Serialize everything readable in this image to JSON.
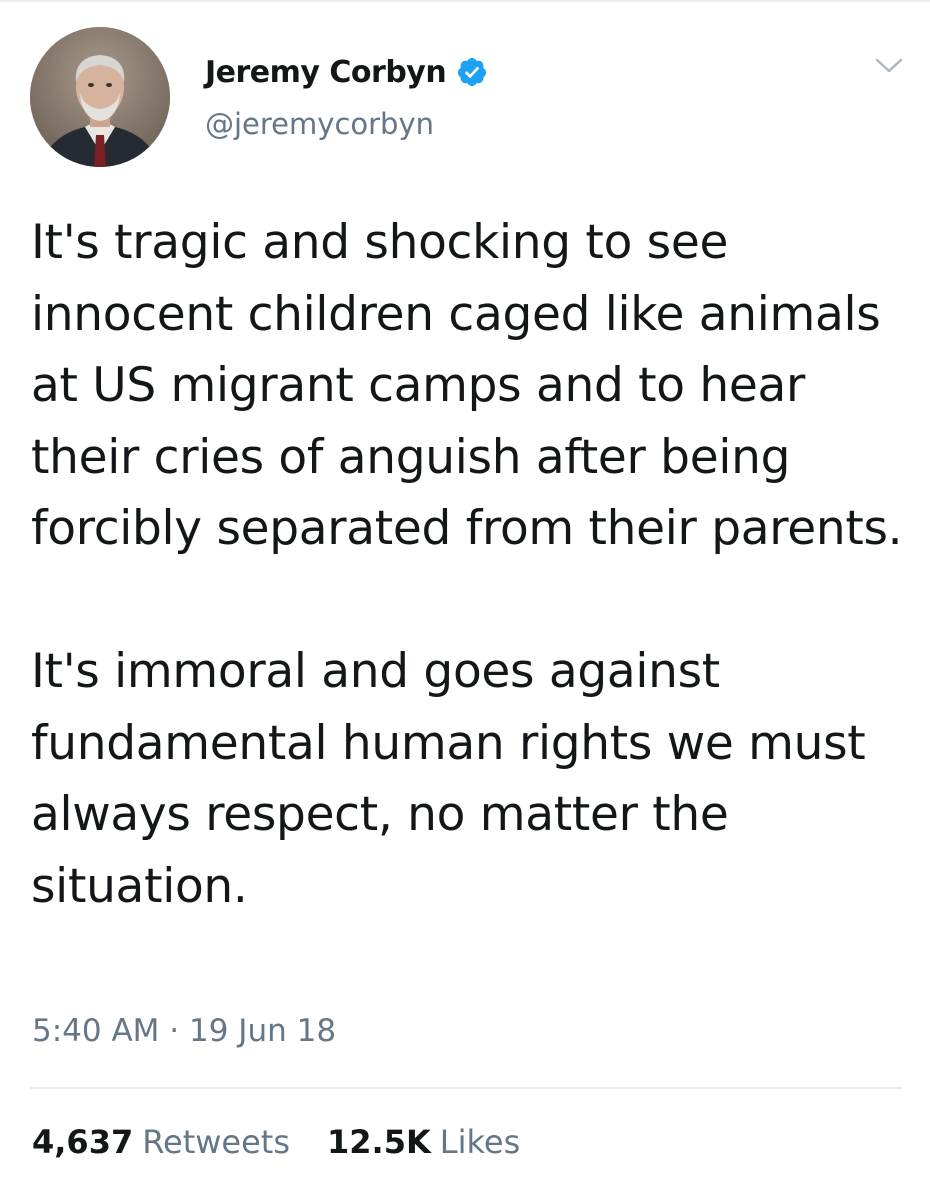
{
  "author": {
    "display_name": "Jeremy Corbyn",
    "handle": "@jeremycorbyn",
    "verified": true
  },
  "icons": {
    "verified": "verified-badge-icon",
    "menu": "chevron-down-icon"
  },
  "tweet": {
    "paragraphs": [
      "It's tragic and shocking to see innocent children caged like animals at US migrant camps and to hear their cries of anguish after being forcibly separated from their parents.",
      "It's immoral and goes against fundamental human rights we must always respect, no matter the situation."
    ],
    "time": "5:40 AM",
    "separator": "·",
    "date": "19 Jun 18"
  },
  "stats": {
    "retweets_count": "4,637",
    "retweets_label": "Retweets",
    "likes_count": "12.5K",
    "likes_label": "Likes"
  },
  "colors": {
    "verified_blue": "#1da1f2",
    "secondary_text": "#657786",
    "primary_text": "#14171a"
  }
}
